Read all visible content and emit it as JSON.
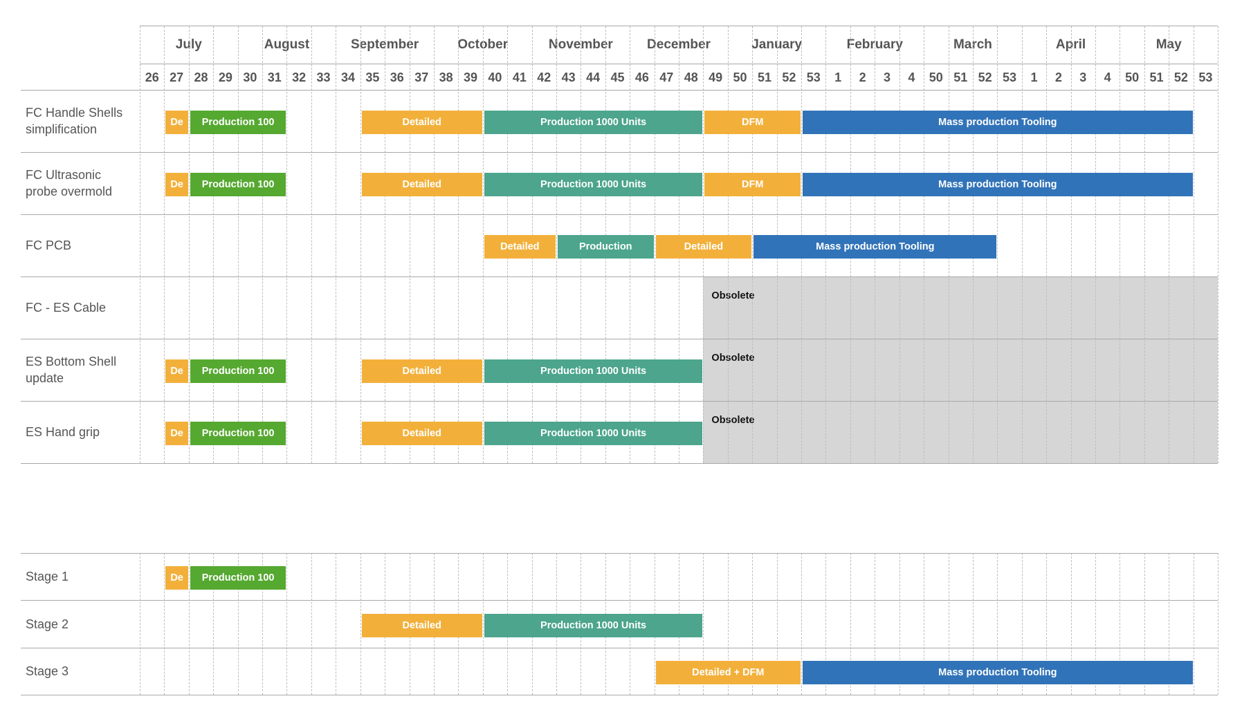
{
  "colors": {
    "design": "#F2B03B",
    "proto": "#55A830",
    "production": "#4CA58C",
    "tooling": "#3173B8",
    "obsolete": "#D6D6D6"
  },
  "months": [
    {
      "label": "July",
      "start": 0,
      "span": 4
    },
    {
      "label": "August",
      "start": 4,
      "span": 4
    },
    {
      "label": "September",
      "start": 8,
      "span": 4
    },
    {
      "label": "October",
      "start": 12,
      "span": 4
    },
    {
      "label": "November",
      "start": 16,
      "span": 4
    },
    {
      "label": "December",
      "start": 20,
      "span": 4
    },
    {
      "label": "January",
      "start": 24,
      "span": 4
    },
    {
      "label": "February",
      "start": 28,
      "span": 4
    },
    {
      "label": "March",
      "start": 32,
      "span": 4
    },
    {
      "label": "April",
      "start": 36,
      "span": 4
    },
    {
      "label": "May",
      "start": 40,
      "span": 4
    }
  ],
  "weeks": [
    "26",
    "27",
    "28",
    "29",
    "30",
    "31",
    "32",
    "33",
    "34",
    "35",
    "36",
    "37",
    "38",
    "39",
    "40",
    "41",
    "42",
    "43",
    "44",
    "45",
    "46",
    "47",
    "48",
    "49",
    "50",
    "51",
    "52",
    "53",
    "1",
    "2",
    "3",
    "4",
    "50",
    "51",
    "52",
    "53",
    "1",
    "2",
    "3",
    "4",
    "50",
    "51",
    "52",
    "53"
  ],
  "rows": [
    {
      "label": "FC Handle Shells simplification",
      "bars": [
        {
          "text": "De",
          "start": 1,
          "end": 2,
          "color": "design"
        },
        {
          "text": "Production 100",
          "start": 2,
          "end": 6,
          "color": "proto"
        },
        {
          "text": "Detailed",
          "start": 9,
          "end": 14,
          "color": "design"
        },
        {
          "text": "Production 1000 Units",
          "start": 14,
          "end": 23,
          "color": "production"
        },
        {
          "text": "DFM",
          "start": 23,
          "end": 27,
          "color": "design"
        },
        {
          "text": "Mass production Tooling",
          "start": 27,
          "end": 43,
          "color": "tooling"
        }
      ]
    },
    {
      "label": "FC Ultrasonic probe overmold",
      "bars": [
        {
          "text": "De",
          "start": 1,
          "end": 2,
          "color": "design"
        },
        {
          "text": "Production 100",
          "start": 2,
          "end": 6,
          "color": "proto"
        },
        {
          "text": "Detailed",
          "start": 9,
          "end": 14,
          "color": "design"
        },
        {
          "text": "Production 1000 Units",
          "start": 14,
          "end": 23,
          "color": "production"
        },
        {
          "text": "DFM",
          "start": 23,
          "end": 27,
          "color": "design"
        },
        {
          "text": "Mass production Tooling",
          "start": 27,
          "end": 43,
          "color": "tooling"
        }
      ]
    },
    {
      "label": "FC PCB",
      "bars": [
        {
          "text": "Detailed",
          "start": 14,
          "end": 17,
          "color": "design"
        },
        {
          "text": "Production",
          "start": 17,
          "end": 21,
          "color": "production"
        },
        {
          "text": "Detailed",
          "start": 21,
          "end": 25,
          "color": "design"
        },
        {
          "text": "Mass production Tooling",
          "start": 25,
          "end": 35,
          "color": "tooling"
        }
      ]
    },
    {
      "label": "FC - ES Cable",
      "bars": [],
      "obsolete": {
        "text": "Obsolete",
        "from": 23
      }
    },
    {
      "label": "ES Bottom Shell update",
      "bars": [
        {
          "text": "De",
          "start": 1,
          "end": 2,
          "color": "design"
        },
        {
          "text": "Production 100",
          "start": 2,
          "end": 6,
          "color": "proto"
        },
        {
          "text": "Detailed",
          "start": 9,
          "end": 14,
          "color": "design"
        },
        {
          "text": "Production 1000 Units",
          "start": 14,
          "end": 23,
          "color": "production"
        }
      ],
      "obsolete": {
        "text": "Obsolete",
        "from": 23
      }
    },
    {
      "label": "ES Hand grip",
      "bars": [
        {
          "text": "De",
          "start": 1,
          "end": 2,
          "color": "design"
        },
        {
          "text": "Production 100",
          "start": 2,
          "end": 6,
          "color": "proto"
        },
        {
          "text": "Detailed",
          "start": 9,
          "end": 14,
          "color": "design"
        },
        {
          "text": "Production 1000 Units",
          "start": 14,
          "end": 23,
          "color": "production"
        }
      ],
      "obsolete": {
        "text": "Obsolete",
        "from": 23
      }
    }
  ],
  "stages": [
    {
      "label": "Stage 1",
      "bars": [
        {
          "text": "De",
          "start": 1,
          "end": 2,
          "color": "design"
        },
        {
          "text": "Production 100",
          "start": 2,
          "end": 6,
          "color": "proto"
        }
      ]
    },
    {
      "label": "Stage 2",
      "bars": [
        {
          "text": "Detailed",
          "start": 9,
          "end": 14,
          "color": "design"
        },
        {
          "text": "Production 1000 Units",
          "start": 14,
          "end": 23,
          "color": "production"
        }
      ]
    },
    {
      "label": "Stage 3",
      "bars": [
        {
          "text": "Detailed + DFM",
          "start": 21,
          "end": 27,
          "color": "design"
        },
        {
          "text": "Mass production Tooling",
          "start": 27,
          "end": 43,
          "color": "tooling"
        }
      ]
    }
  ]
}
